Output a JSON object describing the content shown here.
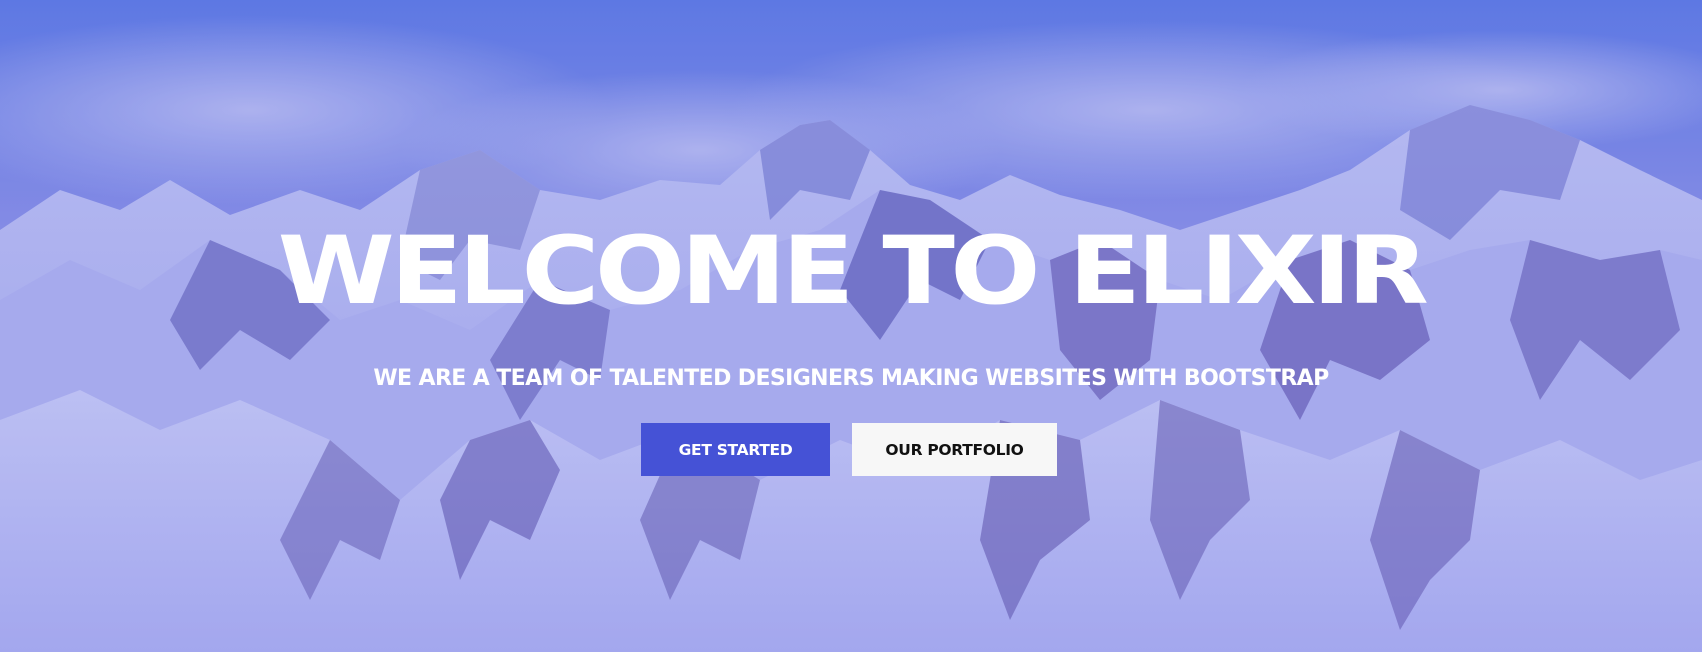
{
  "hero": {
    "title": "WELCOME TO ELIXIR",
    "subtitle": "WE ARE A TEAM OF TALENTED DESIGNERS MAKING WEBSITES WITH BOOTSTRAP",
    "background_image": "snowy-mountain-range-photo",
    "overlay_color": "#5b63e6"
  },
  "buttons": {
    "primary_label": "GET STARTED",
    "primary_color": "#4552d6",
    "secondary_label": "OUR PORTFOLIO",
    "secondary_color": "#f7f7f7"
  }
}
